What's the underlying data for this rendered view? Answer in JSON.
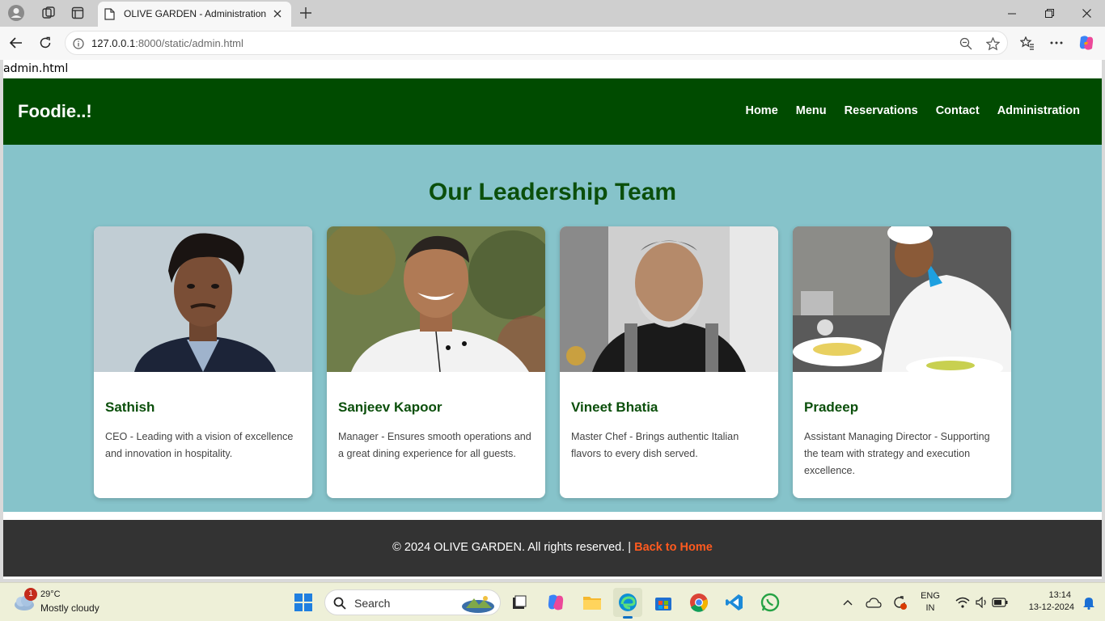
{
  "browser": {
    "tab_title": "OLIVE GARDEN - Administration",
    "url_host": "127.0.0.1",
    "url_rest": ":8000/static/admin.html"
  },
  "page": {
    "file_label": "admin.html",
    "brand": "Foodie..!",
    "nav": [
      "Home",
      "Menu",
      "Reservations",
      "Contact",
      "Administration"
    ],
    "section_title": "Our Leadership Team",
    "team": [
      {
        "name": "Sathish",
        "description": "CEO - Leading with a vision of excellence and innovation in hospitality."
      },
      {
        "name": "Sanjeev Kapoor",
        "description": "Manager - Ensures smooth operations and a great dining experience for all guests."
      },
      {
        "name": "Vineet Bhatia",
        "description": "Master Chef - Brings authentic Italian flavors to every dish served."
      },
      {
        "name": "Pradeep",
        "description": "Assistant Managing Director - Supporting the team with strategy and execution excellence."
      }
    ],
    "footer_text": "© 2024 OLIVE GARDEN. All rights reserved. | ",
    "footer_link": "Back to Home"
  },
  "taskbar": {
    "weather_temp": "29°C",
    "weather_condition": "Mostly cloudy",
    "weather_badge": "1",
    "search_label": "Search",
    "language": "ENG",
    "region": "IN",
    "time": "13:14",
    "date": "13-12-2024"
  },
  "colors": {
    "header_green": "#004b00",
    "section_bg": "#86c3ca",
    "title_green": "#0b4f0b",
    "footer_bg": "#333333",
    "footer_link": "#ff5a1f"
  }
}
